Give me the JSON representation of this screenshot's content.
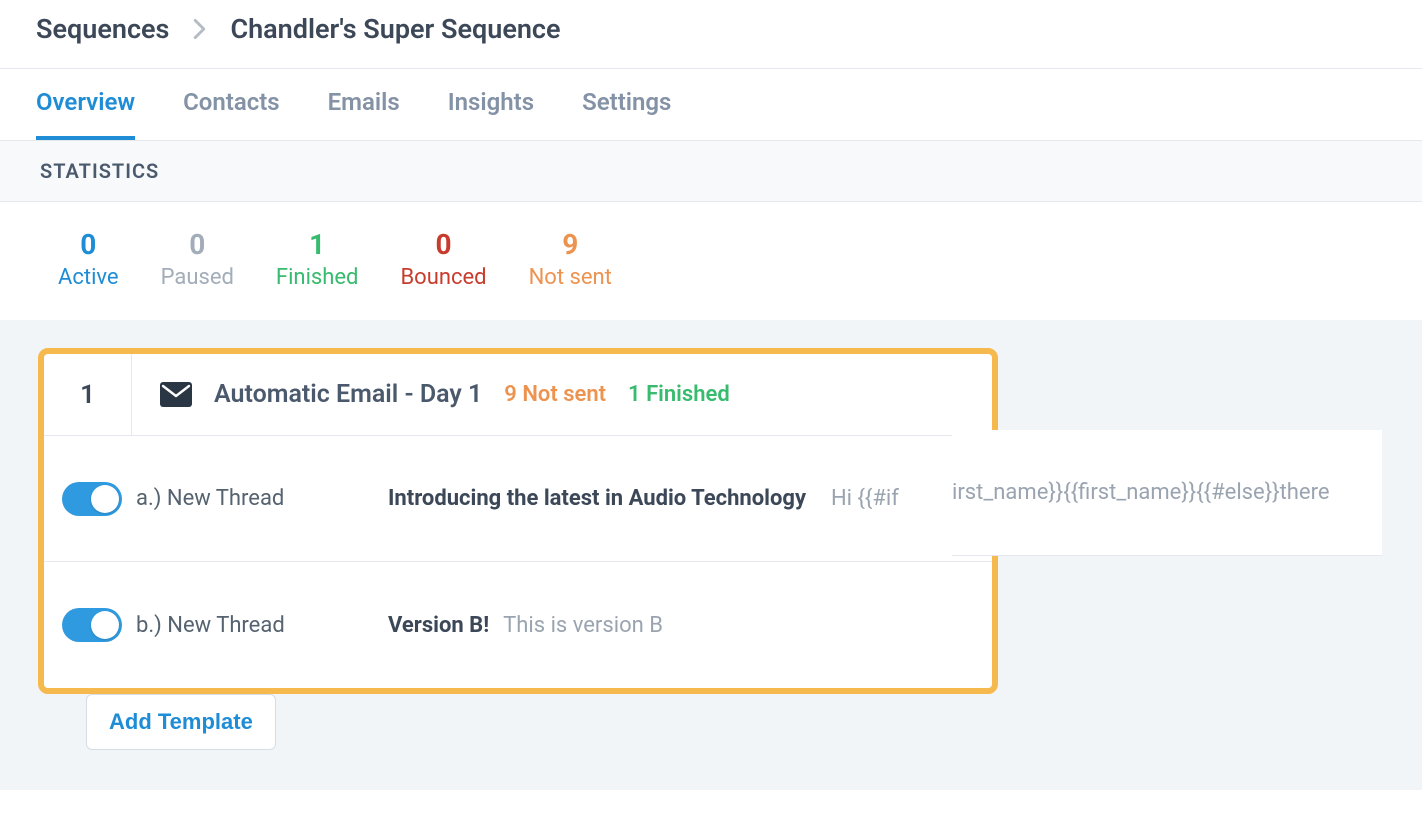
{
  "breadcrumb": {
    "root": "Sequences",
    "current": "Chandler's Super Sequence"
  },
  "tabs": [
    "Overview",
    "Contacts",
    "Emails",
    "Insights",
    "Settings"
  ],
  "active_tab_index": 0,
  "stats_header": "STATISTICS",
  "stats": [
    {
      "value": "0",
      "label": "Active",
      "color": "c-blue"
    },
    {
      "value": "0",
      "label": "Paused",
      "color": "c-gray"
    },
    {
      "value": "1",
      "label": "Finished",
      "color": "c-green"
    },
    {
      "value": "0",
      "label": "Bounced",
      "color": "c-red"
    },
    {
      "value": "9",
      "label": "Not sent",
      "color": "c-orange"
    }
  ],
  "step": {
    "number": "1",
    "title": "Automatic Email - Day 1",
    "status": [
      {
        "text": "9 Not sent",
        "color": "c-orange"
      },
      {
        "text": "1 Finished",
        "color": "c-green"
      }
    ],
    "variants": [
      {
        "key": "a",
        "label": "a.) New Thread",
        "subject": "Introducing the latest in Audio Technology",
        "preview": "Hi {{#if first_name}}{{first_name}}{{#else}}there",
        "toggled": true
      },
      {
        "key": "b",
        "label": "b.) New Thread",
        "subject": "Version B!",
        "preview": "This is version B",
        "toggled": true
      }
    ]
  },
  "add_template_label": "Add Template"
}
